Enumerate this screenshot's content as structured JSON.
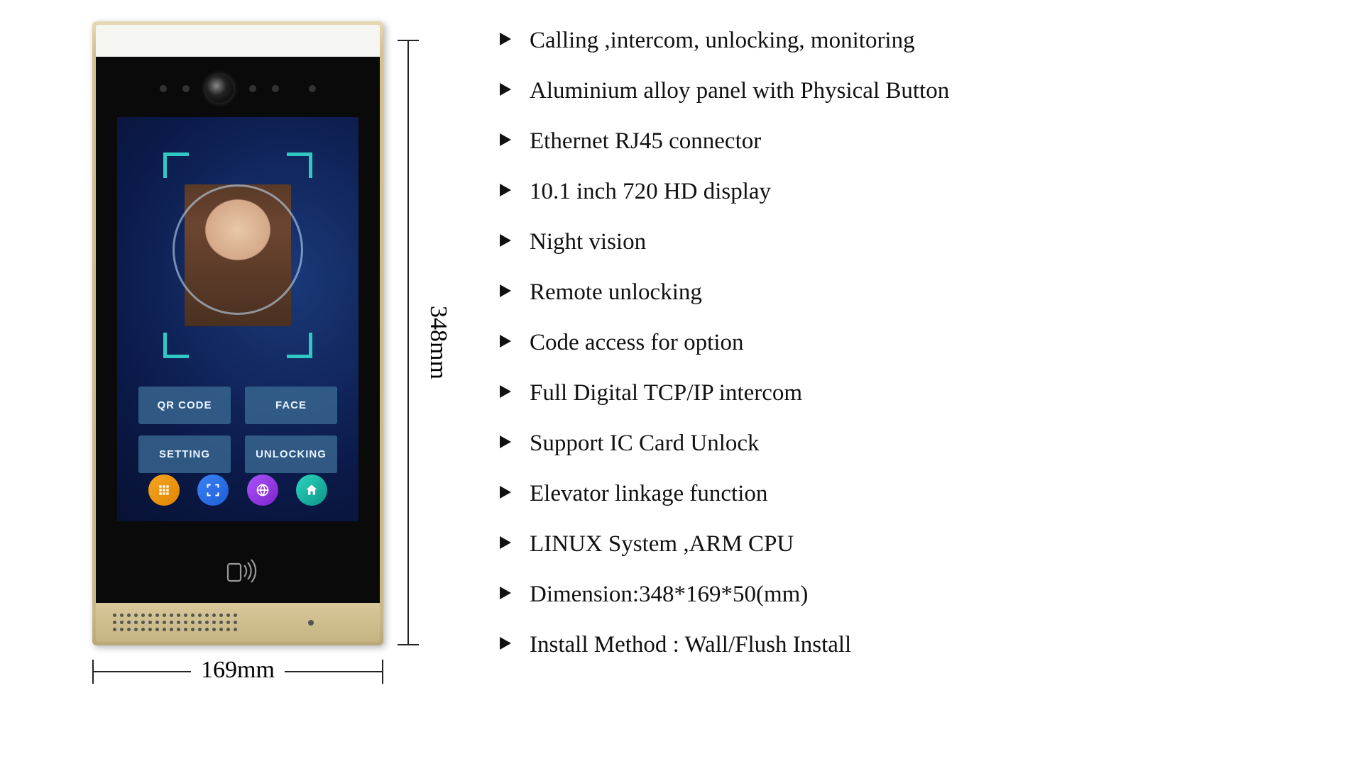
{
  "device": {
    "screen_buttons": {
      "qr_code": "QR CODE",
      "face": "FACE",
      "setting": "SETTING",
      "unlocking": "UNLOCKING"
    },
    "nav_icons": [
      {
        "name": "keypad-icon",
        "color_class": "ic-orange"
      },
      {
        "name": "scan-icon",
        "color_class": "ic-blue"
      },
      {
        "name": "globe-icon",
        "color_class": "ic-purple"
      },
      {
        "name": "home-icon",
        "color_class": "ic-teal"
      }
    ]
  },
  "dimensions": {
    "height_label": "348mm",
    "width_label": "169mm"
  },
  "features": [
    "Calling ,intercom, unlocking, monitoring",
    "Aluminium alloy panel with Physical Button",
    "Ethernet RJ45 connector",
    "10.1 inch 720 HD display",
    "Night vision",
    "Remote unlocking",
    "Code access for option",
    "Full Digital TCP/IP intercom",
    "Support IC Card Unlock",
    "Elevator linkage function",
    "LINUX System ,ARM CPU",
    "Dimension:348*169*50(mm)",
    "Install Method : Wall/Flush Install"
  ]
}
